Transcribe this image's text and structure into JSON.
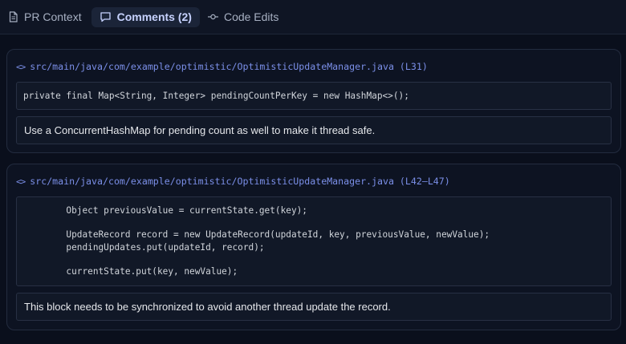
{
  "tabs": [
    {
      "label": "PR Context",
      "icon": "document-icon",
      "active": false
    },
    {
      "label": "Comments (2)",
      "icon": "comment-icon",
      "active": true
    },
    {
      "label": "Code Edits",
      "icon": "commit-icon",
      "active": false
    }
  ],
  "comments": [
    {
      "file_ref": "src/main/java/com/example/optimistic/OptimisticUpdateManager.java (L31)",
      "code": "private final Map<String, Integer> pendingCountPerKey = new HashMap<>();",
      "text": "Use a ConcurrentHashMap for pending count as well to make it thread safe."
    },
    {
      "file_ref": "src/main/java/com/example/optimistic/OptimisticUpdateManager.java (L42–L47)",
      "code": "        Object previousValue = currentState.get(key);\n\n        UpdateRecord record = new UpdateRecord(updateId, key, previousValue, newValue);\n        pendingUpdates.put(updateId, record);\n\n        currentState.put(key, newValue);",
      "text": "This block needs to be synchronized to avoid another thread update the record."
    }
  ],
  "code_icon_glyph": "<>",
  "colors": {
    "accent": "#7b8fe8",
    "background": "#0a0f1c",
    "active_tab_bg": "#1b2438"
  }
}
